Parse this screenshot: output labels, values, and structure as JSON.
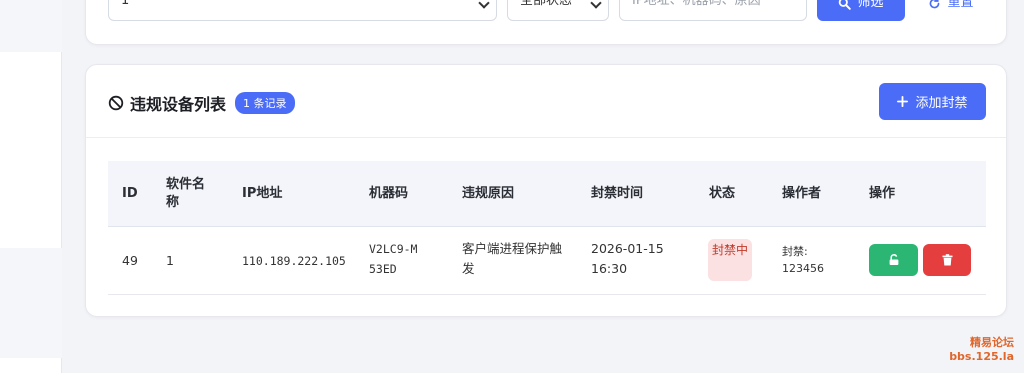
{
  "filters": {
    "software_select": "1",
    "status_select": "全部状态",
    "search_placeholder": "IP地址、机器码、原因",
    "search_button": "筛选",
    "reset_button": "重置"
  },
  "list": {
    "title": "违规设备列表",
    "count_badge": "1 条记录",
    "add_button": "添加封禁",
    "columns": [
      "ID",
      "软件名称",
      "IP地址",
      "机器码",
      "违规原因",
      "封禁时间",
      "状态",
      "操作者",
      "操作"
    ],
    "rows": [
      {
        "id": "49",
        "software": "1",
        "ip": "110.189.222.105",
        "machine_code": "V2LC9-M53ED",
        "reason": "客户端进程保护触发",
        "ban_time": "2026-01-15 16:30",
        "status": "封禁中",
        "operator": "封禁: 123456"
      }
    ]
  },
  "watermark": {
    "line1": "精易论坛",
    "line2": "bbs.125.la"
  },
  "colors": {
    "primary": "#4a6cf7",
    "success": "#2bb673",
    "danger": "#e53e3e",
    "status_bg": "#fbe1e1"
  },
  "icons": [
    "ban-icon",
    "search-icon",
    "reset-icon",
    "plus-icon",
    "unlock-icon",
    "trash-icon"
  ]
}
